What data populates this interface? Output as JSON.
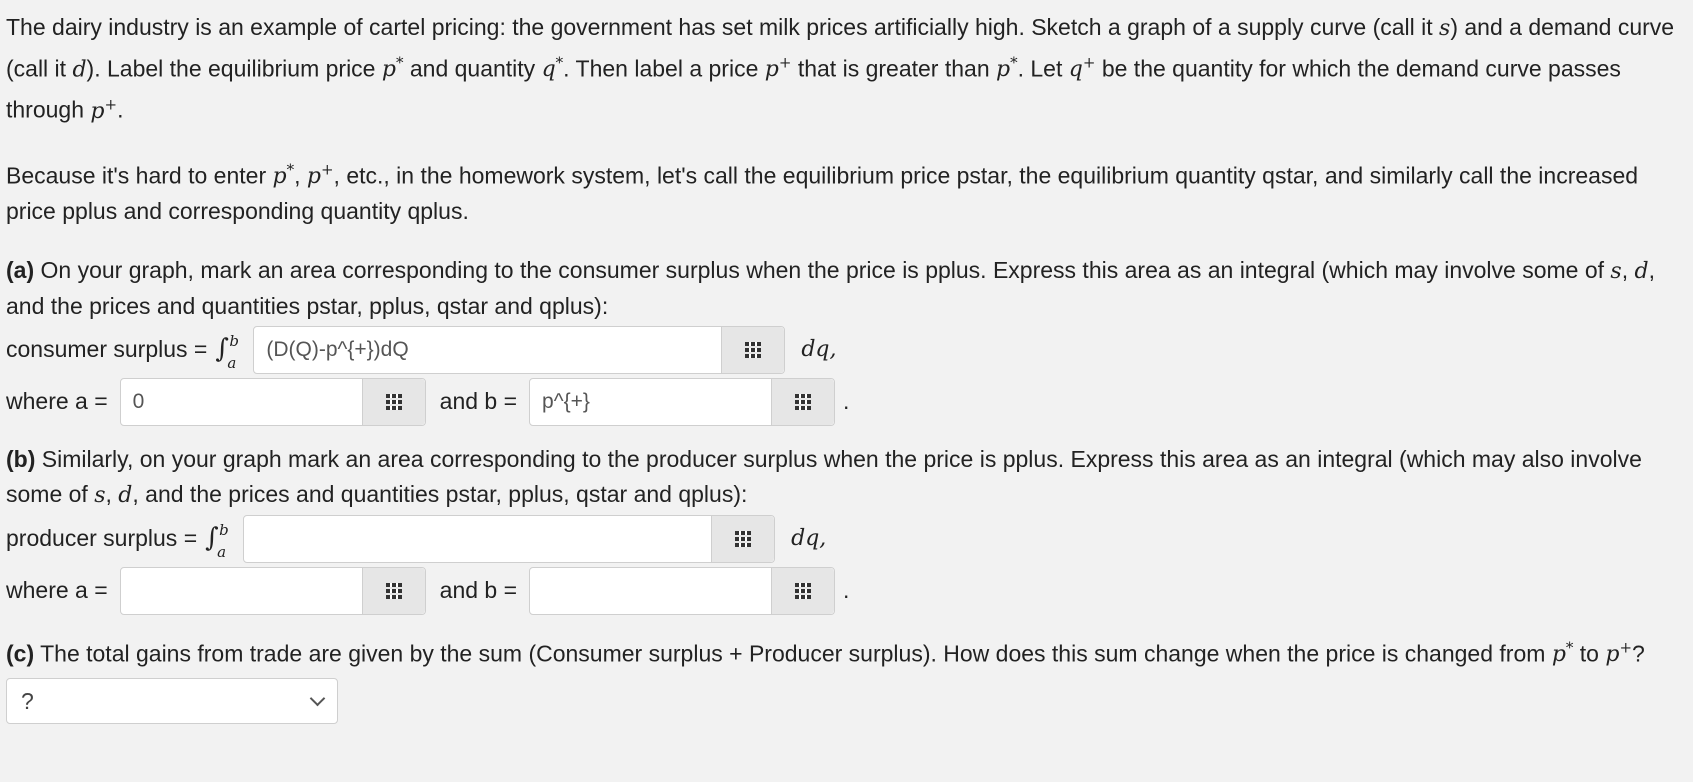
{
  "intro": {
    "l1a": "The dairy industry is an example of cartel pricing: the government has set milk prices artificially high. Sketch a graph of a supply curve (call it ",
    "s": "s",
    "l1b": ") and a demand curve (call it ",
    "d": "d",
    "l1c": "). Label the equilibrium price ",
    "pstar": "p",
    "star": "*",
    "l1d": " and quantity ",
    "qstar": "q",
    "l1e": ". Then label a price ",
    "pplus": "p",
    "plus": "+",
    "l1f": " that is greater than ",
    "l1g": ". Let ",
    "qplus": "q",
    "l1h": " be the quantity for which the demand curve passes through ",
    "l1i": "."
  },
  "para2": {
    "a": "Because it's hard to enter ",
    "b": ", ",
    "c": ", etc., in the homework system, let's call the equilibrium price pstar, the equilibrium quantity qstar, and similarly call the increased price pplus and corresponding quantity qplus."
  },
  "part_a": {
    "tag": "(a)",
    "text1": " On your graph, mark an area corresponding to the consumer surplus when the price is pplus. Express this area as an integral (which may involve some of ",
    "text2": ", and the prices and quantities pstar, pplus, qstar and qplus):",
    "label": "consumer surplus =",
    "integrand": "(D(Q)-p^{+})dQ",
    "dq": "dq,",
    "where_a": "where a =",
    "a_value": "0",
    "and_b": "and b =",
    "b_value": "p^{+}",
    "period": "."
  },
  "part_b": {
    "tag": "(b)",
    "text1": " Similarly, on your graph mark an area corresponding to the producer surplus when the price is pplus. Express this area as an integral (which may also involve some of ",
    "text2": ", and the prices and quantities pstar, pplus, qstar and qplus):",
    "label": "producer surplus =",
    "integrand": "",
    "dq": "dq,",
    "where_a": "where a =",
    "a_value": "",
    "and_b": "and b =",
    "b_value": "",
    "period": "."
  },
  "part_c": {
    "tag": "(c)",
    "text1": " The total gains from trade are given by the sum (Consumer surplus + Producer surplus). How does this sum change when the price is changed from ",
    "text2": " to ",
    "text3": "?",
    "select_value": "?"
  },
  "common": {
    "comma_and": ", and the prices",
    "sep": ", ",
    "s": "s",
    "d": "d",
    "int": "∫",
    "a": "a",
    "b": "b"
  }
}
